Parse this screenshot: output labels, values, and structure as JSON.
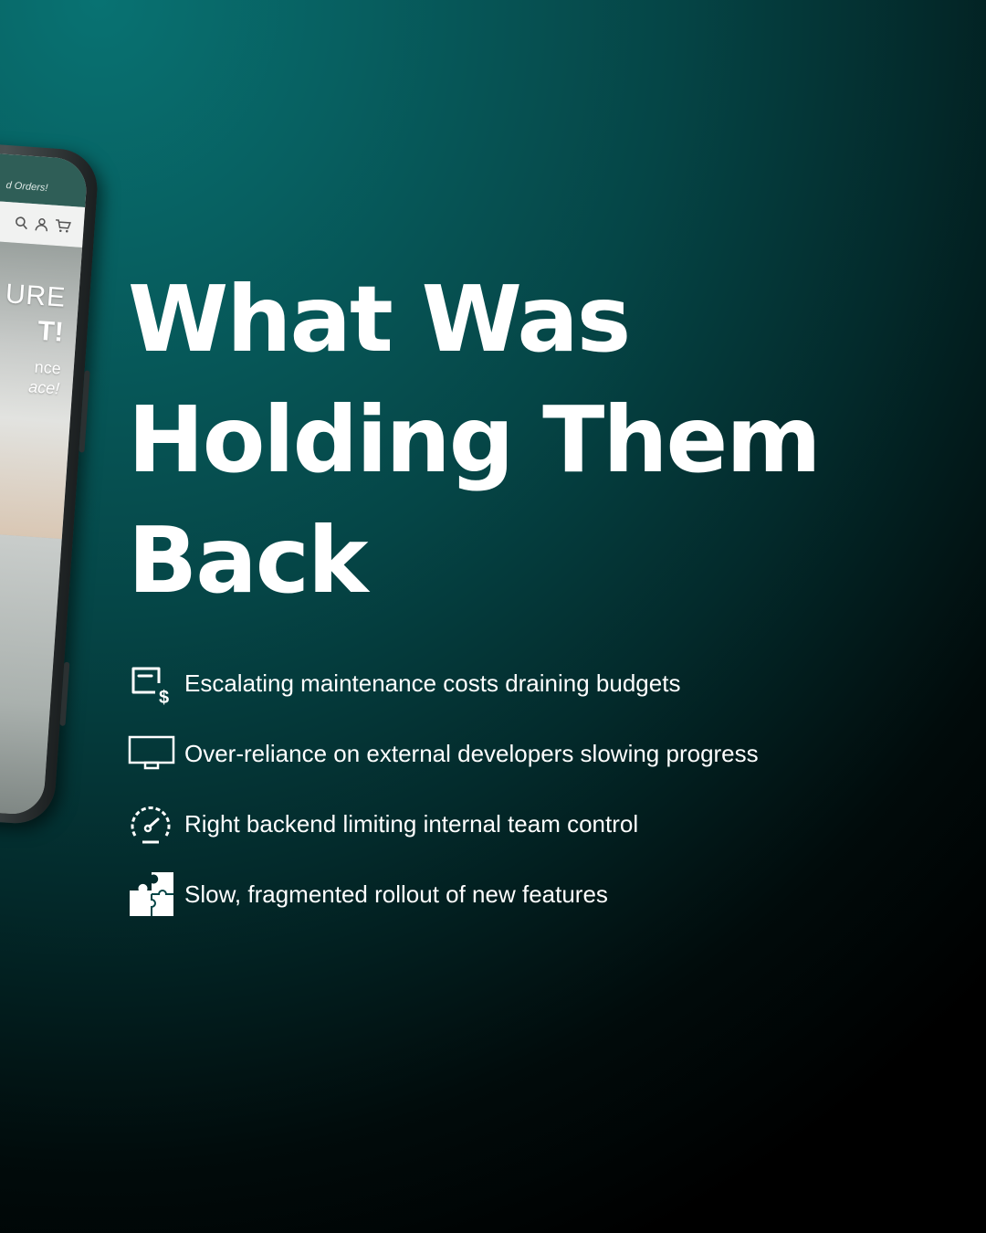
{
  "headline": {
    "line1": "What Was",
    "line2": "Holding Them",
    "line3": "Back"
  },
  "bullets": [
    {
      "icon": "invoice-dollar-icon",
      "text": "Escalating maintenance costs draining budgets"
    },
    {
      "icon": "monitor-icon",
      "text": "Over-reliance on external developers slowing progress"
    },
    {
      "icon": "speedometer-icon",
      "text": "Right backend limiting internal team control"
    },
    {
      "icon": "puzzle-icon",
      "text": "Slow, fragmented rollout of new features"
    }
  ],
  "phone": {
    "banner_text": "d Orders!",
    "hero_line1": "URE",
    "hero_line2": "T!",
    "hero_line3": "nce",
    "hero_line4": "ace!"
  },
  "colors": {
    "background_top": "#087272",
    "background_bottom": "#000000",
    "text": "#ffffff"
  }
}
